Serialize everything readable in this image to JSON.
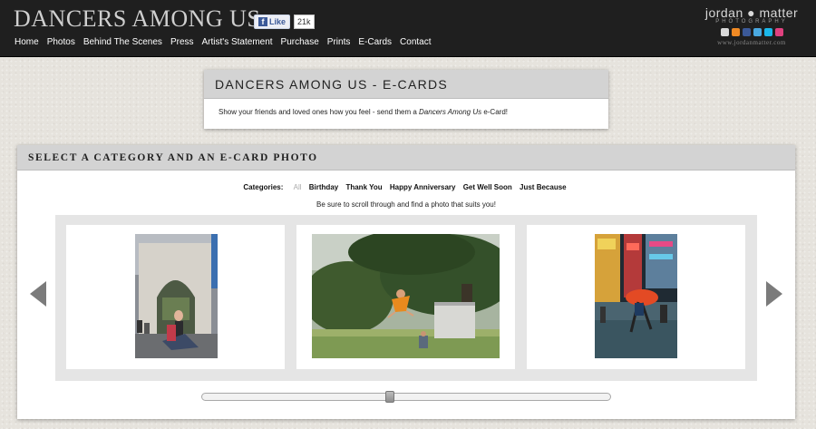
{
  "header": {
    "site_title": "DANCERS AMONG US",
    "fb_like_label": "Like",
    "fb_like_count": "21k",
    "nav": [
      "Home",
      "Photos",
      "Behind The Scenes",
      "Press",
      "Artist's Statement",
      "Purchase",
      "Prints",
      "E-Cards",
      "Contact"
    ],
    "brand_name": "jordan ● matter",
    "brand_sub": "PHOTOGRAPHY",
    "brand_url": "www.jordanmatter.com",
    "social_icons": [
      "mail-icon",
      "rss-icon",
      "facebook-icon",
      "twitter-icon",
      "vimeo-icon",
      "flickr-icon"
    ]
  },
  "ecard_intro": {
    "title": "DANCERS AMONG US - E-CARDS",
    "text_before": "Show your friends and loved ones how you feel - send them a ",
    "text_italic": "Dancers Among Us",
    "text_after": " e-Card!"
  },
  "selector": {
    "title": "SELECT A CATEGORY AND AN E-CARD PHOTO",
    "categories_label": "Categories:",
    "categories": [
      "All",
      "Birthday",
      "Thank You",
      "Happy Anniversary",
      "Get Well Soon",
      "Just Because"
    ],
    "active_category": "All",
    "scroll_note": "Be sure to scroll through and find a photo that suits you!",
    "photos": [
      "washington-square-arch-dancers",
      "dancer-leaping-under-tree",
      "dancer-in-rain-times-square"
    ],
    "slider_position": 0.46
  },
  "colors": {
    "header_bg": "#1f1f1f",
    "panel_header_bg": "#d3d3d3",
    "gallery_bg": "#e5e5e5",
    "arrow": "#7b7b7b"
  }
}
